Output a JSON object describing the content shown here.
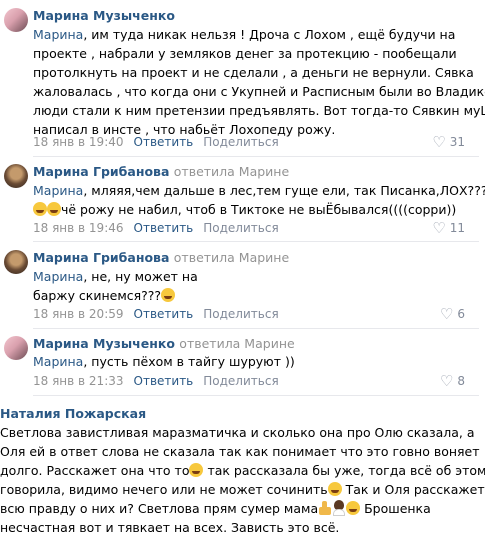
{
  "comments": [
    {
      "author": "Марина Музыченко",
      "replied_to": "",
      "mention": "Марина",
      "lines": [
        ", им туда никак нельзя ! Дроча с Лохом , ещё будучи на",
        "проекте , набрали у земляков денег за протекцию - пообещали",
        "протолкнуть на проект и не сделали , а деньги не вернули. Сявка",
        "жаловалась , что когда они с Укупней и Расписным были во Владике,",
        "люди стали к ним претензии предъявлять. Вот тогда-то Сявкин муШ и",
        "написал в инсте , что набьёт Лохопеду рожу."
      ],
      "time": "18 янв в 19:40",
      "reply_label": "Ответить",
      "share_label": "Поделиться",
      "likes": "31"
    },
    {
      "author": "Марина Грибанова",
      "replied_to": "ответила Марине",
      "mention": "Марина",
      "lines": [
        ", мляяя,чем дальше в лес,тем гуще ели, так Писанка,ЛОХ???",
        "чё рожу не набил, чтоб в Тиктоке не выЁбывался((((сорри))"
      ],
      "time": "18 янв в 19:46",
      "reply_label": "Ответить",
      "share_label": "Поделиться",
      "likes": "11"
    },
    {
      "author": "Марина Грибанова",
      "replied_to": "ответила Марине",
      "mention": "Марина",
      "lines": [
        ", не, ну может на",
        "баржу скинемся???"
      ],
      "time": "18 янв в 20:59",
      "reply_label": "Ответить",
      "share_label": "Поделиться",
      "likes": "6"
    },
    {
      "author": "Марина Музыченко",
      "replied_to": "ответила Марине",
      "mention": "Марина",
      "lines": [
        ", пусть пёхом в тайгу шуруют ))"
      ],
      "time": "18 янв в 21:33",
      "reply_label": "Ответить",
      "share_label": "Поделиться",
      "likes": "8"
    }
  ],
  "comment5": {
    "author": "Наталия Пожарская",
    "lines": [
      "Светлова завистливая маразматичка и сколько она про Олю сказала, а",
      "Оля ей в ответ слова не сказала так как понимает что это говно воняет",
      "долго. Расскажет она что то",
      " так рассказала бы уже, тогда всё об этом",
      "говорила, видимо нечего или не может сочинить",
      " Так и Оля расскажет",
      "всю правду о них и? Светлова прям сумер мама",
      " Брошенка",
      "несчастная вот и тявкает на всех. Зависть это всё."
    ]
  },
  "colors": {
    "link": "#2a5885",
    "meta": "#939393",
    "divider": "#e7e8ec"
  },
  "icons": {
    "like": "heart-icon",
    "emoji": "rofl-emoji-icon"
  }
}
